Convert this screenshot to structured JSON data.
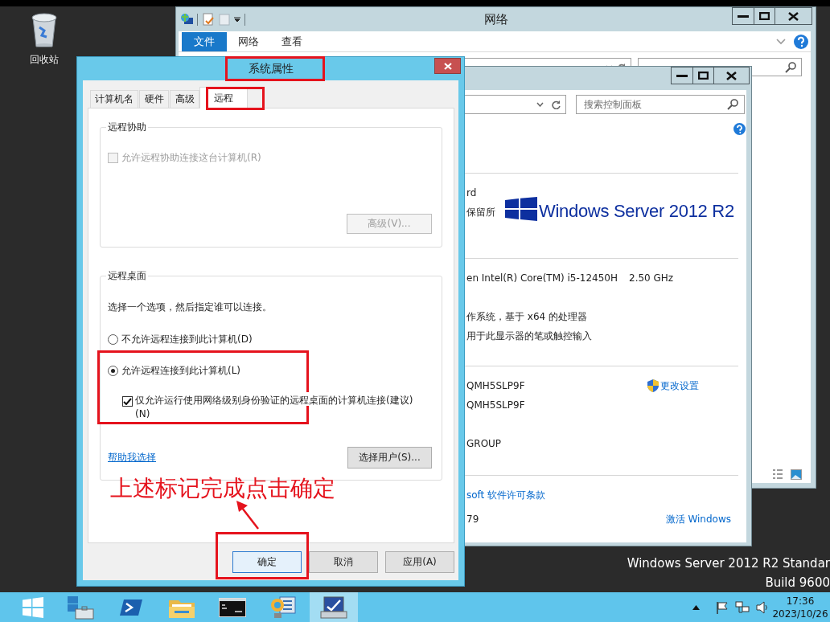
{
  "desktop": {
    "icons": [
      {
        "label": "回收站"
      }
    ],
    "edition": "Windows Server 2012 R2 Standar",
    "build": "Build 9600"
  },
  "network_window": {
    "title": "网络",
    "ribbon_tabs": [
      {
        "label": "文件",
        "selected": true
      },
      {
        "label": "网络",
        "selected": false
      },
      {
        "label": "查看",
        "selected": false
      }
    ]
  },
  "system_window": {
    "search": {
      "placeholder": "搜索控制面板"
    },
    "edition_lines": [
      "rd",
      "保留所"
    ],
    "logo": "Windows Server 2012 R2",
    "processor": "en Intel(R) Core(TM) i5-12450H",
    "processor_speed": "2.50 GHz",
    "system_type": "作系统，基于 x64 的处理器",
    "pen_touch": "用于此显示器的笔或触控输入",
    "computer_name": "QMH5SLP9F",
    "full_computer_name": "QMH5SLP9F",
    "workgroup": "GROUP",
    "change_settings_link": "更改设置",
    "license_link": "soft 软件许可条款",
    "product_id": "79",
    "activate_link": "激活 Windows"
  },
  "dialog": {
    "title": "系统属性",
    "tabs": [
      {
        "label": "计算机名",
        "selected": false
      },
      {
        "label": "硬件",
        "selected": false
      },
      {
        "label": "高级",
        "selected": false
      },
      {
        "label": "远程",
        "selected": true
      }
    ],
    "remote_assistance": {
      "title": "远程协助",
      "checkbox": {
        "label": "允许远程协助连接这台计算机(R)",
        "checked": false,
        "disabled": true
      },
      "advanced_button": {
        "label": "高级(V)...",
        "disabled": true
      }
    },
    "remote_desktop": {
      "title": "远程桌面",
      "instruction": "选择一个选项，然后指定谁可以连接。",
      "options": [
        {
          "label": "不允许远程连接到此计算机(D)",
          "selected": false
        },
        {
          "label": "允许远程连接到此计算机(L)",
          "selected": true
        }
      ],
      "nla_checkbox": {
        "label": "仅允许运行使用网络级别身份验证的远程桌面的计算机连接(建议)(N)",
        "checked": true,
        "disabled": false
      },
      "help_link": "帮助我选择",
      "select_users_button": {
        "label": "选择用户(S)...",
        "disabled": false
      }
    },
    "buttons": [
      {
        "label": "确定",
        "focused": true
      },
      {
        "label": "取消",
        "focused": false
      },
      {
        "label": "应用(A)",
        "focused": false
      }
    ]
  },
  "annotation": {
    "text": "上述标记完成点击确定"
  },
  "taskbar": {
    "apps": [
      {
        "kind": "server-manager",
        "active": false
      },
      {
        "kind": "powershell",
        "active": false
      },
      {
        "kind": "explorer",
        "active": false
      },
      {
        "kind": "console",
        "active": false
      },
      {
        "kind": "control-panel",
        "active": false
      },
      {
        "kind": "system",
        "active": true
      }
    ],
    "clock": {
      "time": "17:36",
      "date": "2023/10/26"
    }
  }
}
